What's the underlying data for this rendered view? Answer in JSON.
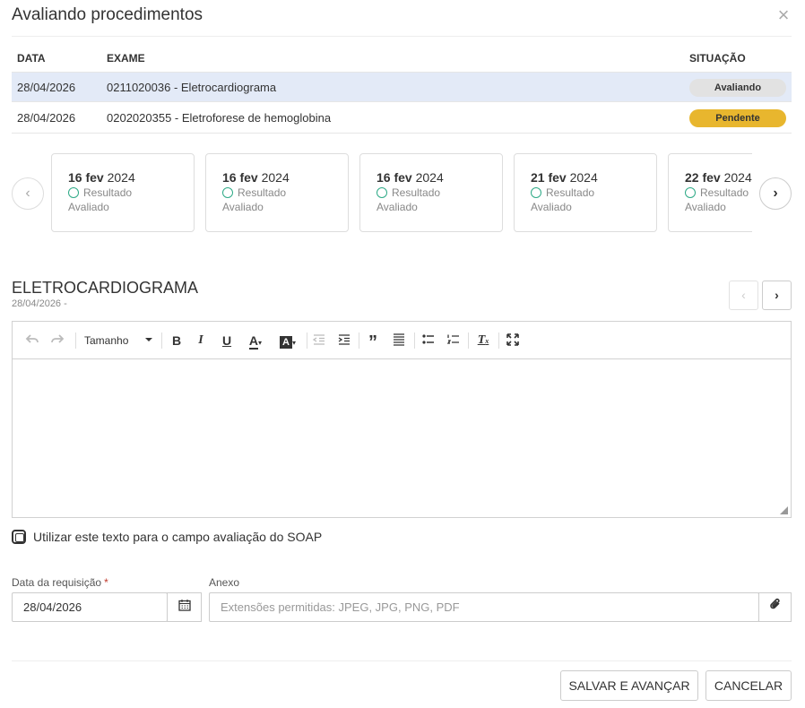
{
  "dialog": {
    "title": "Avaliando procedimentos",
    "close_label": "×"
  },
  "table": {
    "headers": {
      "date": "DATA",
      "exam": "EXAME",
      "status": "SITUAÇÃO"
    },
    "rows": [
      {
        "date": "28/04/2026",
        "exam": "0211020036 - Eletrocardiograma",
        "status": "Avaliando"
      },
      {
        "date": "28/04/2026",
        "exam": "0202020355 - Eletroforese de hemoglobina",
        "status": "Pendente"
      }
    ]
  },
  "carousel": {
    "prev_icon": "‹",
    "next_icon": "›",
    "cards": [
      {
        "day_month": "16 fev",
        "year": "2024",
        "result": "Resultado",
        "status": "Avaliado"
      },
      {
        "day_month": "16 fev",
        "year": "2024",
        "result": "Resultado",
        "status": "Avaliado"
      },
      {
        "day_month": "16 fev",
        "year": "2024",
        "result": "Resultado",
        "status": "Avaliado"
      },
      {
        "day_month": "21 fev",
        "year": "2024",
        "result": "Resultado",
        "status": "Avaliado"
      },
      {
        "day_month": "22 fev",
        "year": "2024",
        "result": "Resultado",
        "status": "Avaliado"
      }
    ]
  },
  "section": {
    "title": "ELETROCARDIOGRAMA",
    "subtitle": "28/04/2026 -",
    "prev_icon": "‹",
    "next_icon": "›"
  },
  "toolbar": {
    "font_size_label": "Tamanho"
  },
  "checkbox": {
    "label": "Utilizar este texto para o campo avaliação do SOAP"
  },
  "form": {
    "date_label": "Data da requisição",
    "required_mark": "*",
    "date_value": "28/04/2026",
    "attachment_label": "Anexo",
    "attachment_placeholder": "Extensões permitidas: JPEG, JPG, PNG, PDF"
  },
  "buttons": {
    "save_label": "SALVAR E AVANÇAR",
    "cancel_label": "CANCELAR"
  },
  "colors": {
    "selected_row": "#e3eaf7",
    "pending_badge": "#e8b62e",
    "evaluating_badge": "#e2e2e2",
    "result_ring": "#2eaa87"
  }
}
